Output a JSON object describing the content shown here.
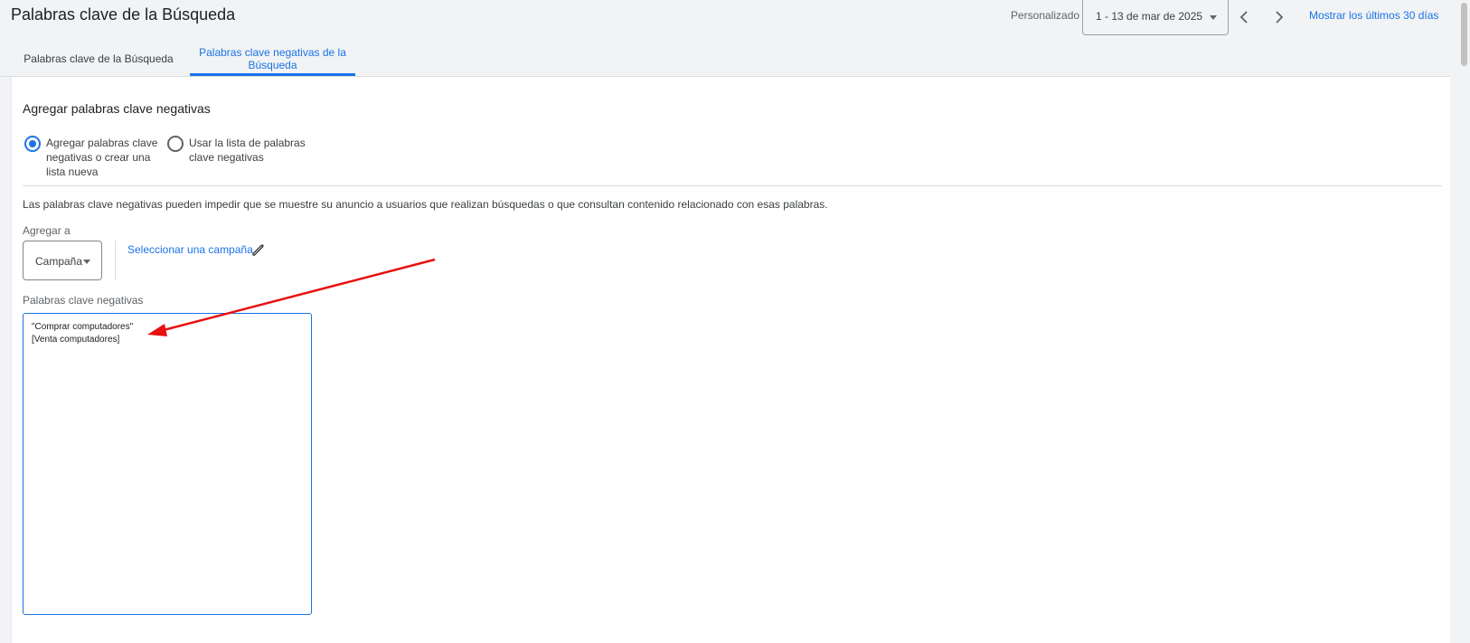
{
  "header": {
    "title": "Palabras clave de la Búsqueda",
    "date_mode": "Personalizado",
    "date_range": "1 - 13 de mar de 2025",
    "show_last_30": "Mostrar los últimos 30 días"
  },
  "tabs": [
    {
      "label": "Palabras clave de la Búsqueda"
    },
    {
      "label": "Palabras clave negativas de la Búsqueda",
      "active": true
    }
  ],
  "form": {
    "section_title": "Agregar palabras clave negativas",
    "radio_options": [
      {
        "label": "Agregar palabras clave negativas o crear una lista nueva",
        "selected": true
      },
      {
        "label": "Usar la lista de palabras clave negativas",
        "selected": false
      }
    ],
    "info_text": "Las palabras clave negativas pueden impedir que se muestre su anuncio a usuarios que realizan búsquedas o que consultan contenido relacionado con esas palabras.",
    "add_to_label": "Agregar a",
    "add_to_value": "Campaña",
    "select_campaign_link": "Seleccionar una campaña",
    "keywords_label": "Palabras clave negativas",
    "keywords": [
      "\"Comprar computadores\"",
      "[Venta computadores]"
    ]
  },
  "colors": {
    "accent": "#1a73e8",
    "annotation_arrow": "#e8100f",
    "background": "#f1f3f4",
    "card": "#ffffff"
  },
  "icons": [
    "chevron-left-icon",
    "chevron-right-icon",
    "dropdown-caret-icon",
    "pencil-icon",
    "radio-selected-icon",
    "radio-unselected-icon"
  ]
}
